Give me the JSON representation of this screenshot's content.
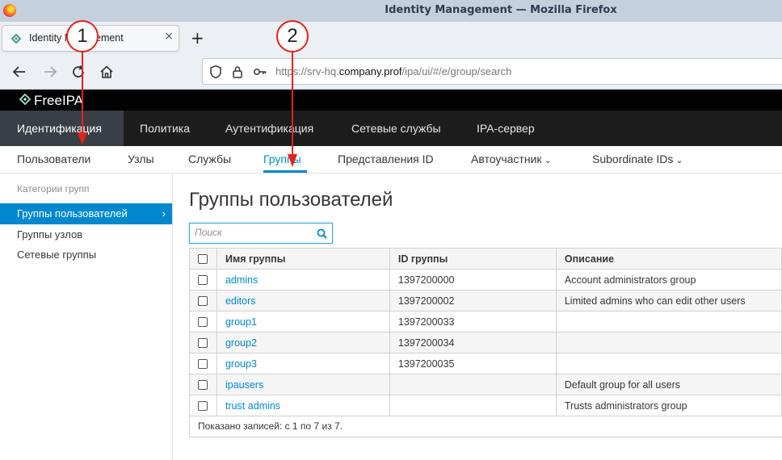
{
  "window": {
    "title": "Identity Management — Mozilla Firefox"
  },
  "browser": {
    "tab_title": "Identity Management",
    "new_tab_label": "+",
    "tab_close_label": "×",
    "url_host_prefix": "https://srv-hq.",
    "url_domain": "company.prof",
    "url_path": "/ipa/ui/#/e/group/search"
  },
  "brand": {
    "name": "FreeIPA"
  },
  "main_nav": [
    {
      "label": "Идентификация"
    },
    {
      "label": "Политика"
    },
    {
      "label": "Аутентификация"
    },
    {
      "label": "Сетевые службы"
    },
    {
      "label": "IPA-сервер"
    }
  ],
  "sub_nav": [
    {
      "label": "Пользователи"
    },
    {
      "label": "Узлы"
    },
    {
      "label": "Службы"
    },
    {
      "label": "Группы"
    },
    {
      "label": "Представления ID"
    },
    {
      "label": "Автоучастник"
    },
    {
      "label": "Subordinate IDs"
    }
  ],
  "sidebar": {
    "heading": "Категории групп",
    "items": [
      {
        "label": "Группы пользователей"
      },
      {
        "label": "Группы узлов"
      },
      {
        "label": "Сетевые группы"
      }
    ]
  },
  "page": {
    "title": "Группы пользователей",
    "search_placeholder": "Поиск"
  },
  "table": {
    "columns": [
      "Имя группы",
      "ID группы",
      "Описание"
    ],
    "rows": [
      {
        "name": "admins",
        "gid": "1397200000",
        "description": "Account administrators group"
      },
      {
        "name": "editors",
        "gid": "1397200002",
        "description": "Limited admins who can edit other users"
      },
      {
        "name": "group1",
        "gid": "1397200033",
        "description": ""
      },
      {
        "name": "group2",
        "gid": "1397200034",
        "description": ""
      },
      {
        "name": "group3",
        "gid": "1397200035",
        "description": ""
      },
      {
        "name": "ipausers",
        "gid": "",
        "description": "Default group for all users"
      },
      {
        "name": "trust admins",
        "gid": "",
        "description": "Trusts administrators group"
      }
    ],
    "footer": "Показано записей: с 1 по 7 из 7."
  },
  "callouts": [
    {
      "number": "1"
    },
    {
      "number": "2"
    }
  ],
  "colors": {
    "accent": "#0088ce",
    "callout": "#e2231a",
    "header_bg": "#1d1d1d"
  }
}
